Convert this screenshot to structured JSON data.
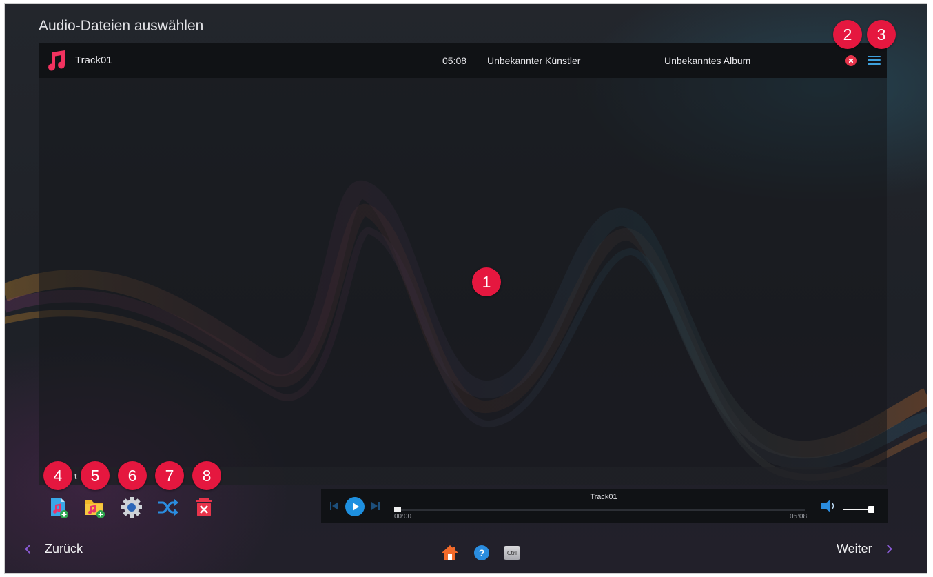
{
  "page": {
    "title": "Audio-Dateien auswählen"
  },
  "tracks": [
    {
      "name": "Track01",
      "duration": "05:08",
      "artist": "Unbekannter Künstler",
      "album": "Unbekanntes Album"
    }
  ],
  "badges": [
    "1",
    "2",
    "3",
    "4",
    "5",
    "6",
    "7",
    "8"
  ],
  "status_bar": {
    "text": "t"
  },
  "toolbar": {
    "icons": [
      "add-audio-file-icon",
      "add-audio-folder-icon",
      "settings-gear-icon",
      "shuffle-icon",
      "delete-all-icon"
    ]
  },
  "player": {
    "track_title": "Track01",
    "current_time": "00:00",
    "total_time": "05:08",
    "progress": 0,
    "volume": 1.0
  },
  "nav": {
    "back_label": "Zurück",
    "next_label": "Weiter",
    "ctrl_label": "Ctrl",
    "help_label": "?"
  },
  "colors": {
    "badge": "#e5173f",
    "accent_blue": "#1e90e0",
    "nav_arrow": "#8a5bd6",
    "remove_red": "#e8344b"
  }
}
